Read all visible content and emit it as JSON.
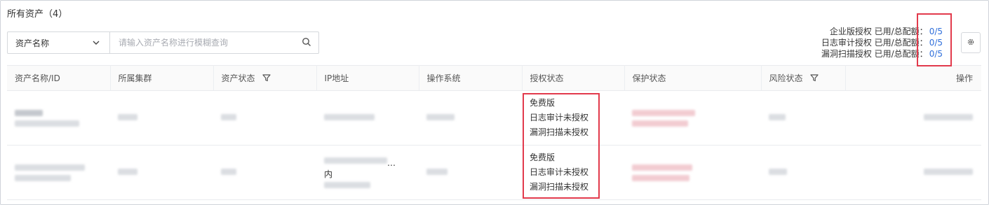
{
  "page": {
    "title": "所有资产（4）"
  },
  "search": {
    "select_value": "资产名称",
    "placeholder": "请输入资产名称进行模糊查询"
  },
  "licenses": [
    {
      "label": "企业版授权 已用/总配额：",
      "value": "0/5"
    },
    {
      "label": "日志审计授权 已用/总配额：",
      "value": "0/5"
    },
    {
      "label": "漏洞扫描授权 已用/总配额：",
      "value": "0/5"
    }
  ],
  "table": {
    "columns": [
      "资产名称/ID",
      "所属集群",
      "资产状态",
      "IP地址",
      "操作系统",
      "授权状态",
      "保护状态",
      "风险状态",
      "操作"
    ],
    "rows": [
      {
        "auth_status": [
          "免费版",
          "日志审计未授权",
          "漏洞扫描未授权"
        ]
      },
      {
        "auth_status": [
          "免费版",
          "日志审计未授权",
          "漏洞扫描未授权"
        ],
        "ip_partial_1": "…",
        "ip_partial_2": "内"
      }
    ]
  },
  "colors": {
    "accent": "#2f6fdb",
    "highlight_box": "#e23a4c"
  },
  "icons": [
    "chevron-down-icon",
    "search-icon",
    "filter-icon",
    "gear-icon"
  ]
}
